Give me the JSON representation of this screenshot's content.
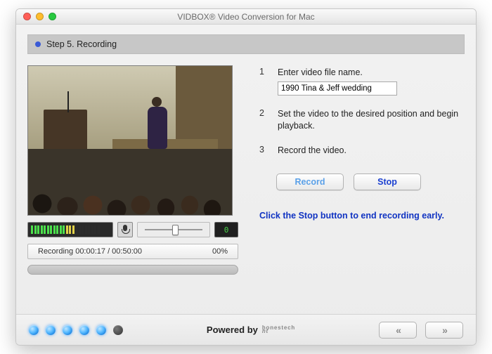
{
  "window": {
    "title": "VIDBOX® Video Conversion for Mac"
  },
  "step": {
    "label": "Step 5. Recording"
  },
  "player": {
    "audio_count": "0",
    "status_label": "Recording 00:00:17 / 00:50:00",
    "progress_pct": "00%"
  },
  "instructions": {
    "i1": {
      "num": "1",
      "text": "Enter video file name."
    },
    "i2": {
      "num": "2",
      "text": "Set the video to the desired position and begin playback."
    },
    "i3": {
      "num": "3",
      "text": "Record the video."
    },
    "filename": "1990 Tina & Jeff wedding",
    "record_label": "Record",
    "stop_label": "Stop",
    "hint": "Click the Stop button to end recording early."
  },
  "footer": {
    "powered_by": "Powered by",
    "brand": "ht",
    "brand_sub": "honestech",
    "prev": "«",
    "next": "»"
  }
}
